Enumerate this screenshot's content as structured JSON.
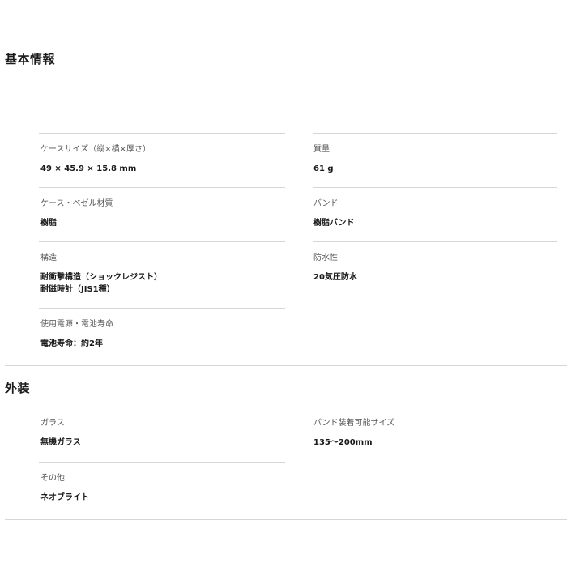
{
  "sections": [
    {
      "title": "基本情報",
      "left": [
        {
          "label": "ケースサイズ（縦×横×厚さ）",
          "value": "49 × 45.9 × 15.8 mm"
        },
        {
          "label": "ケース・ベゼル材質",
          "value": "樹脂"
        },
        {
          "label": "構造",
          "value_lines": [
            "耐衝撃構造（ショックレジスト）",
            "耐磁時計（JIS1種）"
          ]
        },
        {
          "label": "使用電源・電池寿命",
          "value": "電池寿命：約2年"
        }
      ],
      "right": [
        {
          "label": "質量",
          "value": "61 g"
        },
        {
          "label": "バンド",
          "value": "樹脂バンド"
        },
        {
          "label": "防水性",
          "value": "20気圧防水"
        }
      ]
    },
    {
      "title": "外装",
      "left": [
        {
          "label": "ガラス",
          "value": "無機ガラス"
        },
        {
          "label": "その他",
          "value": "ネオブライト"
        }
      ],
      "right": [
        {
          "label": "バンド装着可能サイズ",
          "value": "135～200mm"
        }
      ]
    }
  ]
}
